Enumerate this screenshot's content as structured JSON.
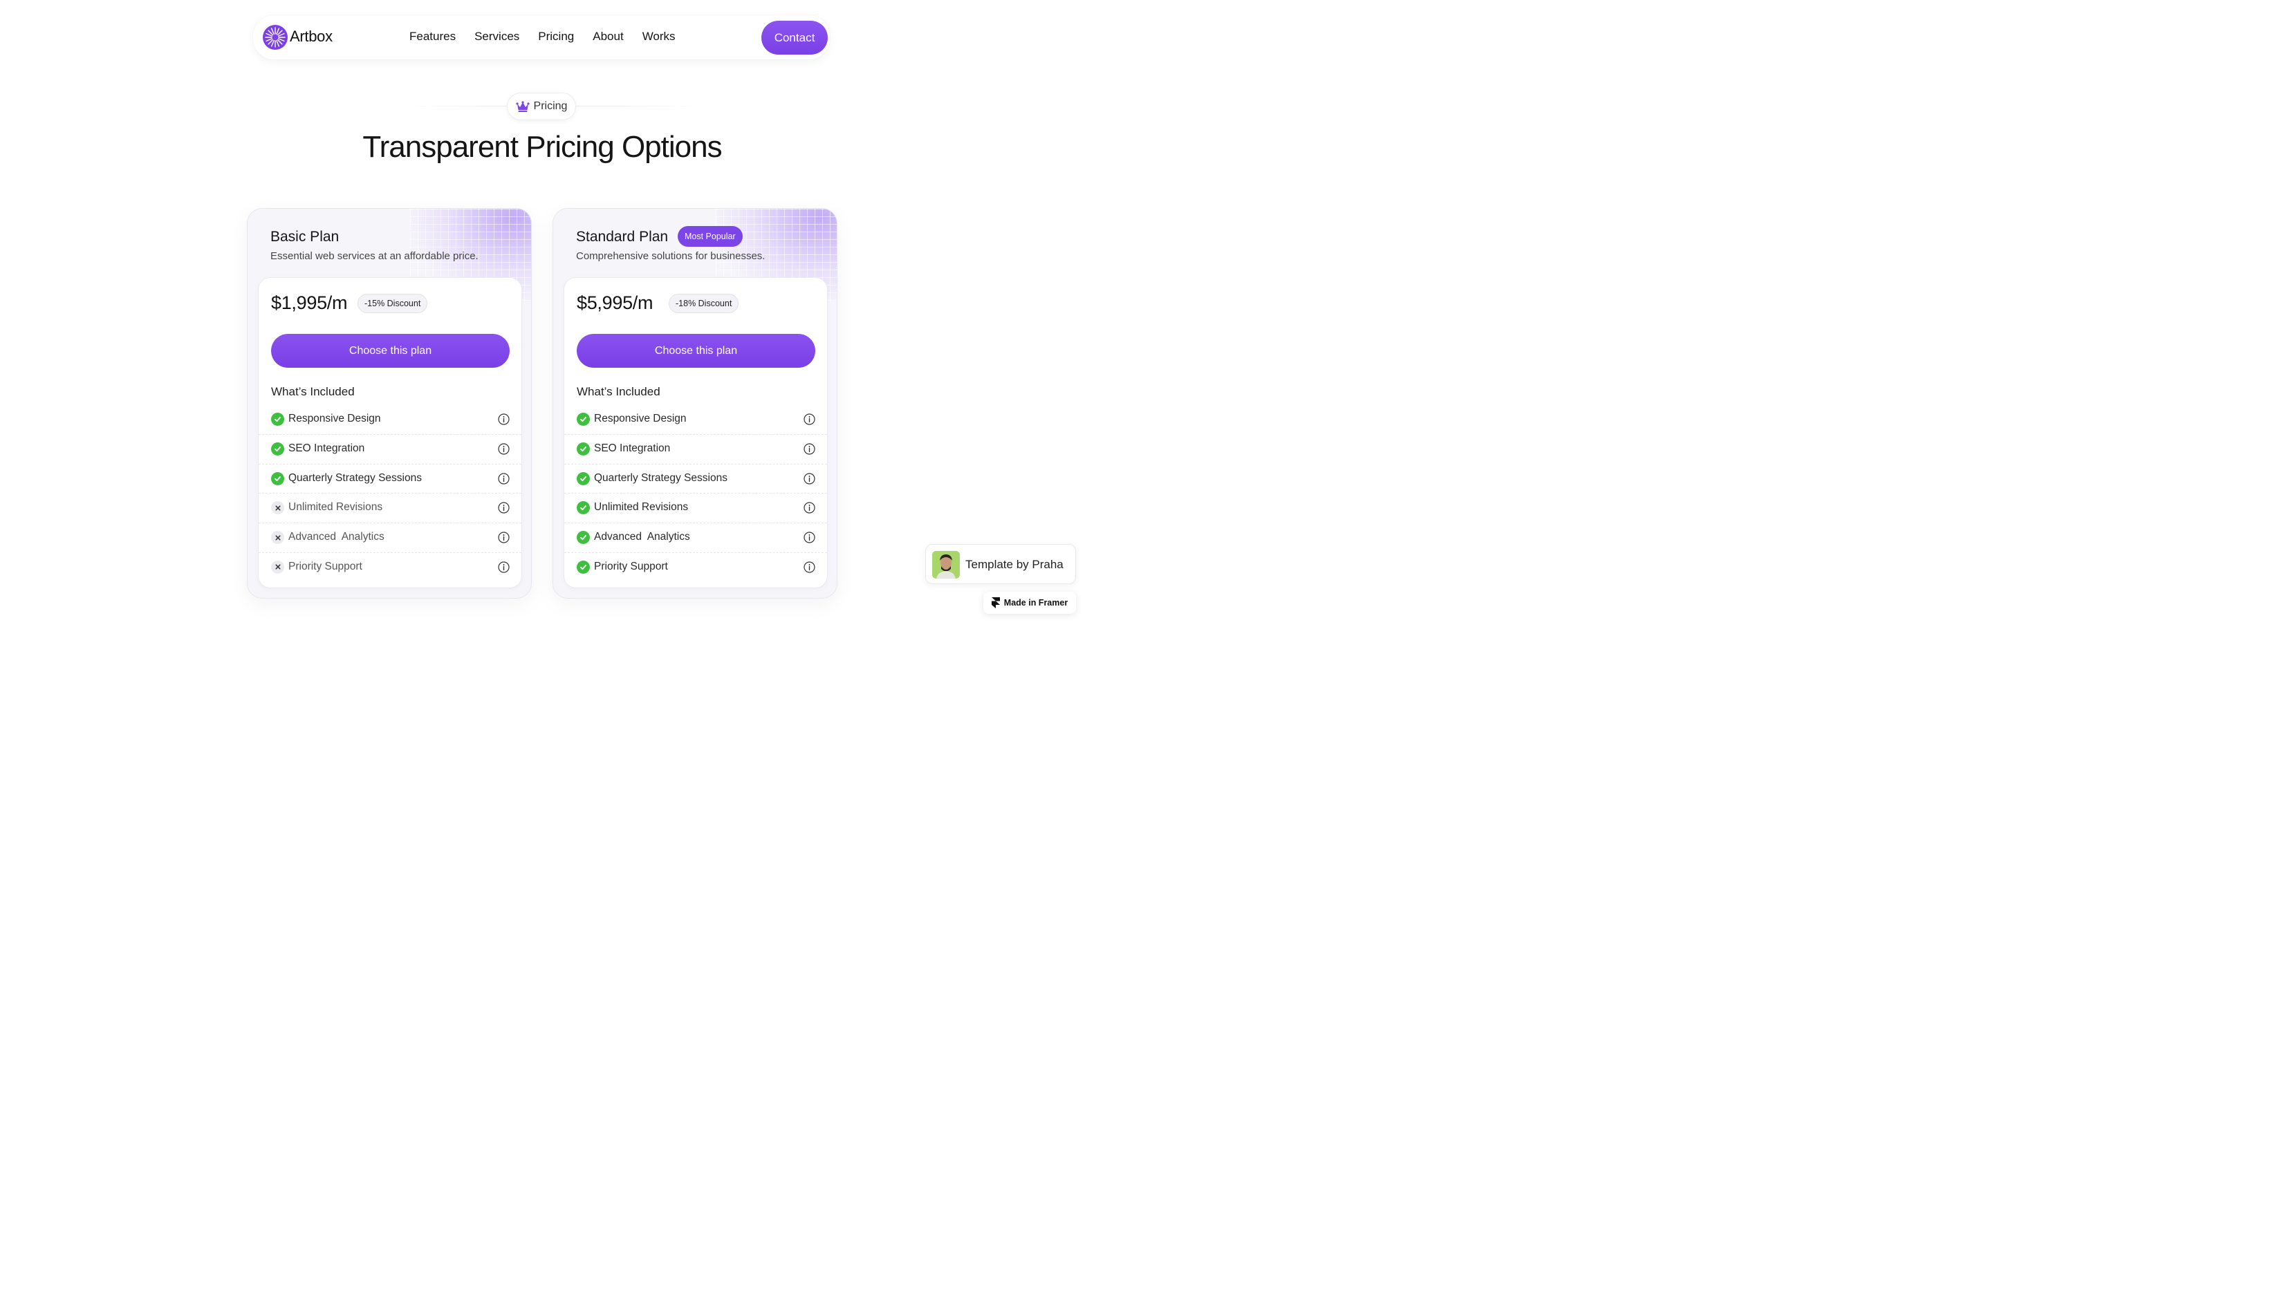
{
  "nav": {
    "brand": "Artbox",
    "links": [
      "Features",
      "Services",
      "Pricing",
      "About",
      "Works"
    ],
    "contact_label": "Contact"
  },
  "section": {
    "badge_label": "Pricing",
    "title": "Transparent Pricing Options"
  },
  "plans": [
    {
      "name": "Basic Plan",
      "description": "Essential web services at an affordable price.",
      "price": "$1,995/m",
      "discount": "-15% Discount",
      "button_label": "Choose this plan",
      "included_title": "What’s Included",
      "features": [
        {
          "label": "Responsive Design",
          "included": true
        },
        {
          "label": "SEO Integration",
          "included": true
        },
        {
          "label": "Quarterly Strategy Sessions",
          "included": true
        },
        {
          "label": "Unlimited Revisions",
          "included": false
        },
        {
          "label": "Advanced  Analytics",
          "included": false
        },
        {
          "label": "Priority Support",
          "included": false
        }
      ]
    },
    {
      "name": "Standard Plan",
      "badge": "Most Popular",
      "description": "Comprehensive solutions for businesses.",
      "price": "$5,995/m",
      "discount": "-18% Discount",
      "button_label": "Choose this plan",
      "included_title": "What’s Included",
      "features": [
        {
          "label": "Responsive Design",
          "included": true
        },
        {
          "label": "SEO Integration",
          "included": true
        },
        {
          "label": "Quarterly Strategy Sessions",
          "included": true
        },
        {
          "label": "Unlimited Revisions",
          "included": true
        },
        {
          "label": "Advanced  Analytics",
          "included": true
        },
        {
          "label": "Priority Support",
          "included": true
        }
      ]
    }
  ],
  "template_badge": {
    "label": "Template by Praha"
  },
  "framer_badge": {
    "label": "Made in Framer"
  },
  "colors": {
    "accent": "#7c45e8",
    "check": "#3fbf3f",
    "text": "#141414"
  },
  "icons": {
    "logo": "sunburst-logo-icon",
    "crown": "crown-icon",
    "included": "check-circle-icon",
    "excluded": "x-circle-icon",
    "info": "info-icon",
    "framer": "framer-logo-icon"
  }
}
